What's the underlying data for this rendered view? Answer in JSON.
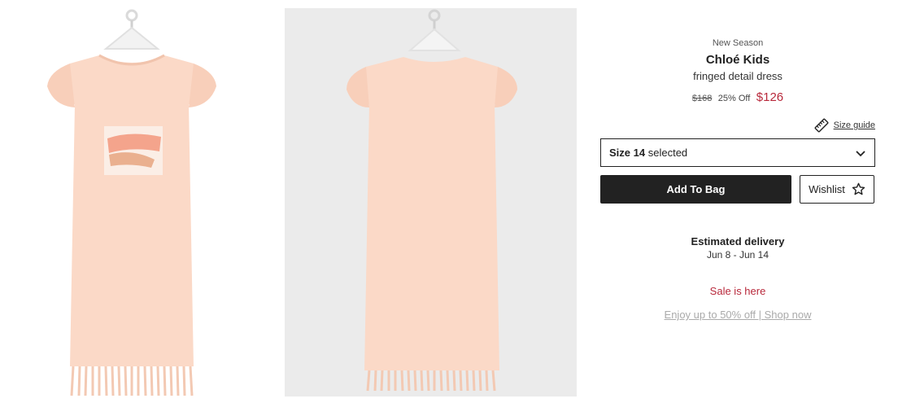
{
  "gallery": {
    "images": [
      {
        "view": "front",
        "icon": "dress-front-image"
      },
      {
        "view": "back",
        "icon": "dress-back-image"
      }
    ]
  },
  "product": {
    "season_label": "New Season",
    "brand": "Chloé Kids",
    "name": "fringed detail dress",
    "price": {
      "original": "$168",
      "discount": "25% Off",
      "sale": "$126",
      "sale_color": "#b8283b"
    }
  },
  "size_guide": {
    "label": "Size guide",
    "icon": "ruler-icon"
  },
  "size_select": {
    "size_prefix": "Size",
    "size_value": "14",
    "suffix": "selected",
    "icon": "chevron-down-icon"
  },
  "actions": {
    "add_to_bag": "Add To Bag",
    "wishlist": "Wishlist",
    "wishlist_icon": "star-icon"
  },
  "delivery": {
    "title": "Estimated delivery",
    "dates": "Jun 8 - Jun 14"
  },
  "promo": {
    "heading": "Sale is here",
    "link": "Enjoy up to 50% off | Shop now"
  },
  "colors": {
    "dress": "#fbd9c7",
    "accent_red": "#b8283b",
    "button_dark": "#222222"
  }
}
